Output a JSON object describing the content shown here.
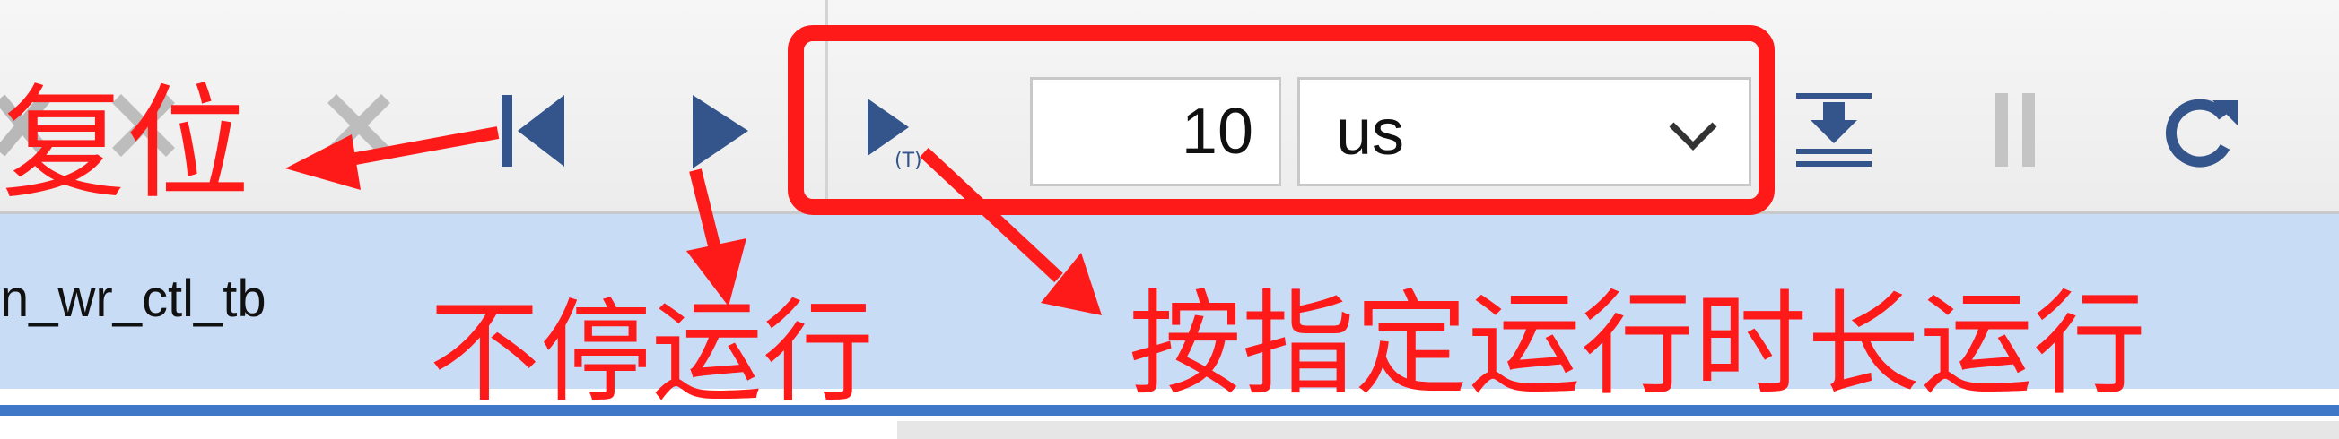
{
  "toolbar": {
    "time_value": "10",
    "time_unit": "us",
    "unit_options": [
      "us"
    ]
  },
  "scope": {
    "instance_name": "n_wr_ctl_tb"
  },
  "annotations": {
    "reset": "复位",
    "run_all": "不停运行",
    "run_for": "按指定运行时长运行"
  },
  "colors": {
    "annotation_red": "#ff1a1a",
    "icon_blue": "#34558b",
    "highlight_row": "#c9dcf6"
  },
  "icons": [
    "remove-icon",
    "reset-icon",
    "run-all-icon",
    "run-for-time-icon",
    "step-icon",
    "break-icon",
    "relaunch-icon"
  ]
}
